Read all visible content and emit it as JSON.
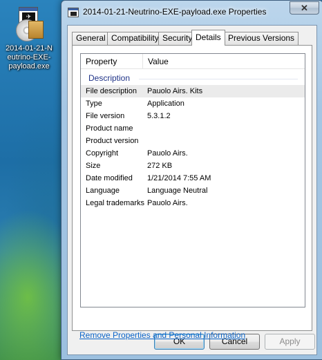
{
  "desktop": {
    "icon_label": "2014-01-21-Neutrino-EXE-payload.exe"
  },
  "window": {
    "title": "2014-01-21-Neutrino-EXE-payload.exe Properties",
    "close_glyph": "✕",
    "tabs": [
      {
        "label": "General"
      },
      {
        "label": "Compatibility"
      },
      {
        "label": "Security"
      },
      {
        "label": "Details",
        "active": true
      },
      {
        "label": "Previous Versions"
      }
    ]
  },
  "details": {
    "columns": {
      "property": "Property",
      "value": "Value"
    },
    "group_title": "Description",
    "rows": [
      {
        "property": "File description",
        "value": "Pauolo Airs. Kits",
        "selected": true
      },
      {
        "property": "Type",
        "value": "Application"
      },
      {
        "property": "File version",
        "value": "5.3.1.2"
      },
      {
        "property": "Product name",
        "value": ""
      },
      {
        "property": "Product version",
        "value": ""
      },
      {
        "property": "Copyright",
        "value": "Pauolo Airs."
      },
      {
        "property": "Size",
        "value": "272 KB"
      },
      {
        "property": "Date modified",
        "value": "1/21/2014 7:55 AM"
      },
      {
        "property": "Language",
        "value": "Language Neutral"
      },
      {
        "property": "Legal trademarks",
        "value": "Pauolo Airs."
      }
    ]
  },
  "footer": {
    "remove_link": "Remove Properties and Personal Information",
    "ok_label": "OK",
    "cancel_label": "Cancel",
    "apply_label": "Apply",
    "apply_enabled": false
  },
  "colors": {
    "group_title": "#1e3287",
    "link": "#0b64c8",
    "selected_row": "#ebebeb"
  }
}
